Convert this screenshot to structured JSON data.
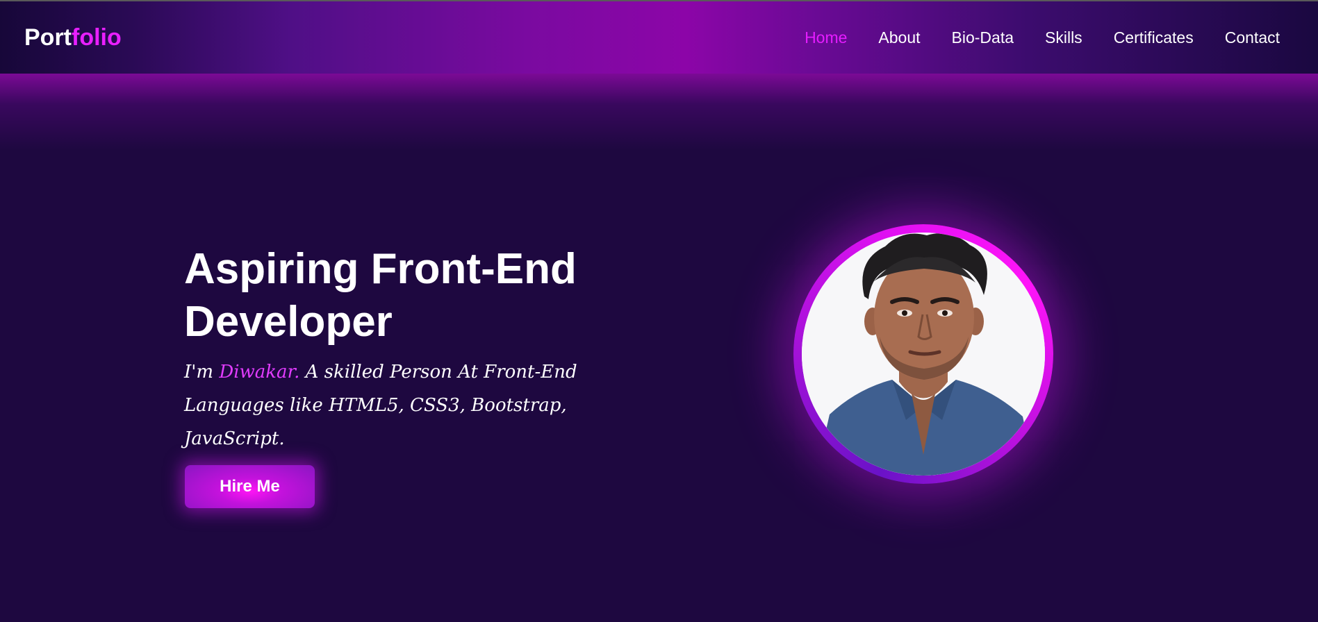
{
  "brand": {
    "prefix": "Port",
    "accent": "folio"
  },
  "nav": {
    "items": [
      {
        "label": "Home",
        "active": true
      },
      {
        "label": "About",
        "active": false
      },
      {
        "label": "Bio-Data",
        "active": false
      },
      {
        "label": "Skills",
        "active": false
      },
      {
        "label": "Certificates",
        "active": false
      },
      {
        "label": "Contact",
        "active": false
      }
    ]
  },
  "hero": {
    "title": "Aspiring Front-End Developer",
    "intro_prefix": "I'm ",
    "name": "Diwakar.",
    "intro_rest": " A skilled Person At Front-End Languages like HTML5, CSS3, Bootstrap, JavaScript.",
    "button_label": "Hire Me"
  },
  "colors": {
    "accent": "#e91fff",
    "background": "#1e0840",
    "text": "#ffffff"
  }
}
